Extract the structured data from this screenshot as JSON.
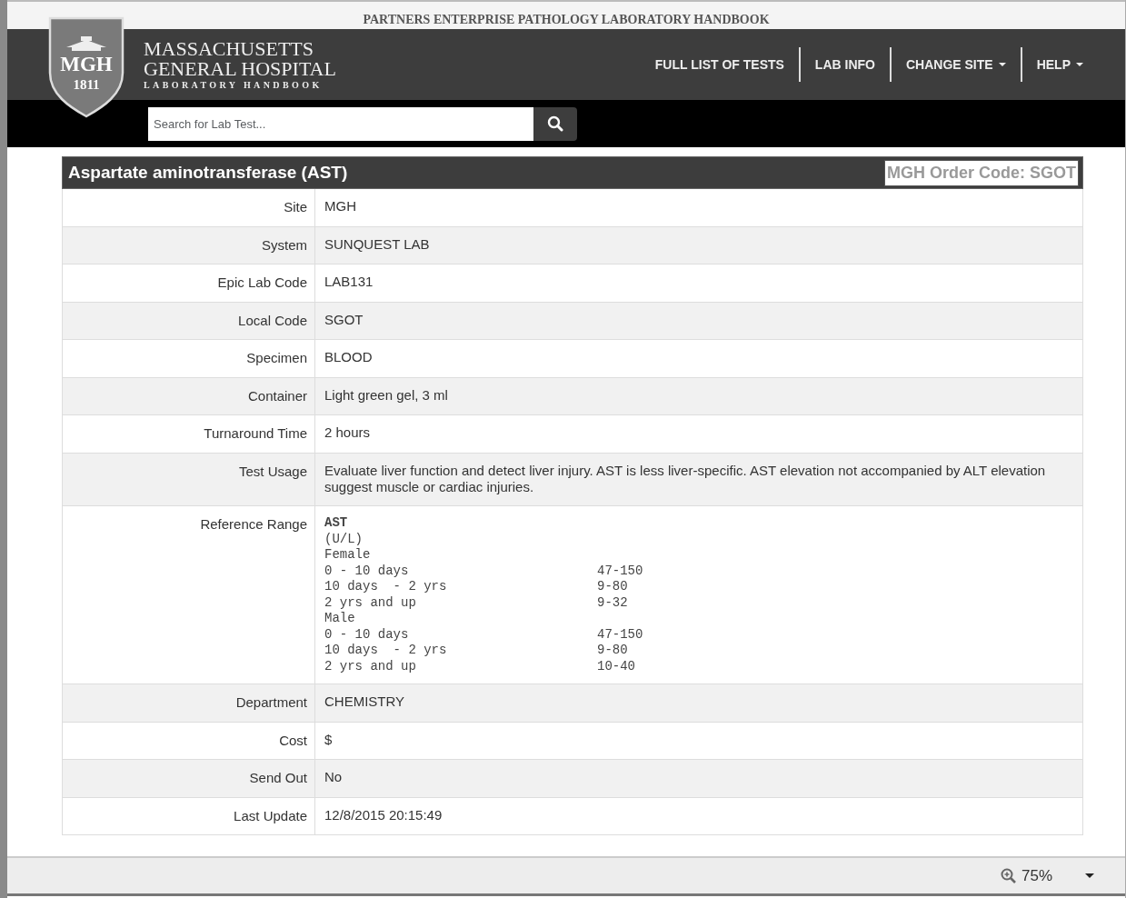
{
  "site_title": "PARTNERS ENTERPRISE PATHOLOGY LABORATORY HANDBOOK",
  "logo": {
    "abbr": "MGH",
    "year": "1811",
    "line_1": "MASSACHUSETTS",
    "line_2": "GENERAL HOSPITAL",
    "line_3": "LABORATORY HANDBOOK"
  },
  "nav": [
    {
      "label": "FULL LIST OF TESTS",
      "dropdown": false
    },
    {
      "label": "LAB INFO",
      "dropdown": false
    },
    {
      "label": "CHANGE SITE",
      "dropdown": true
    },
    {
      "label": "HELP",
      "dropdown": true
    }
  ],
  "search": {
    "placeholder": "Search for Lab Test..."
  },
  "test": {
    "title": "Aspartate aminotransferase (AST)",
    "order_code": "MGH Order Code: SGOT",
    "rows": [
      {
        "label": "Site",
        "value": "MGH"
      },
      {
        "label": "System",
        "value": "SUNQUEST LAB"
      },
      {
        "label": "Epic Lab Code",
        "value": "LAB131"
      },
      {
        "label": "Local Code",
        "value": "SGOT"
      },
      {
        "label": "Specimen",
        "value": "BLOOD"
      },
      {
        "label": "Container",
        "value": "Light green gel, 3 ml"
      },
      {
        "label": "Turnaround Time",
        "value": "2 hours"
      },
      {
        "label": "Test Usage",
        "value": "Evaluate liver function and detect liver injury.  AST is less liver-specific.  AST elevation not accompanied by ALT elevation suggest muscle or cardiac injuries."
      },
      {
        "label": "Reference Range",
        "kind": "range",
        "heading": "AST",
        "lines": [
          {
            "text": "(U/L)"
          },
          {
            "text": "Female"
          },
          {
            "text": "0 - 10 days",
            "value": "47-150"
          },
          {
            "text": "10 days  - 2 yrs",
            "value": "9-80"
          },
          {
            "text": "2 yrs and up",
            "value": "9-32"
          },
          {
            "text": "Male"
          },
          {
            "text": "0 - 10 days",
            "value": "47-150"
          },
          {
            "text": "10 days  - 2 yrs",
            "value": "9-80"
          },
          {
            "text": "2 yrs and up",
            "value": "10-40"
          }
        ]
      },
      {
        "label": "Department",
        "value": "CHEMISTRY"
      },
      {
        "label": "Cost",
        "value": "$"
      },
      {
        "label": "Send Out",
        "value": "No"
      },
      {
        "label": "Last Update",
        "value": "12/8/2015 20:15:49"
      }
    ]
  },
  "status_bar": {
    "zoom": "75%"
  }
}
